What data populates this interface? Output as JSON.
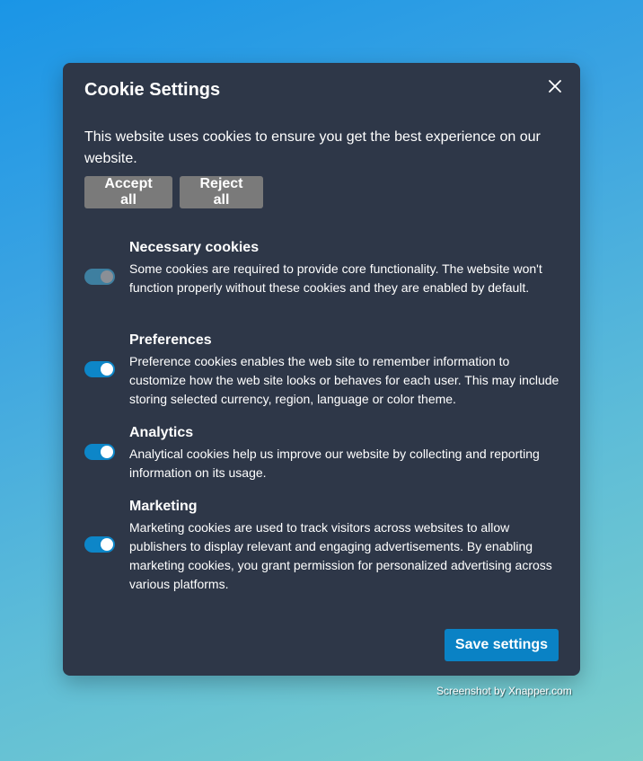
{
  "dialog": {
    "title": "Cookie Settings",
    "intro": "This website uses cookies to ensure you get the best experience on our website.",
    "accept_all_label": "Accept all",
    "reject_all_label": "Reject all",
    "close_icon": "close-icon",
    "save_label": "Save settings"
  },
  "categories": [
    {
      "title": "Necessary cookies",
      "description": "Some cookies are required to provide core functionality. The website won't function properly without these cookies and they are enabled by default.",
      "enabled": true,
      "disabled": true
    },
    {
      "title": "Preferences",
      "description": "Preference cookies enables the web site to remember information to customize how the web site looks or behaves for each user. This may include storing selected currency, region, language or color theme.",
      "enabled": true,
      "disabled": false
    },
    {
      "title": "Analytics",
      "description": "Analytical cookies help us improve our website by collecting and reporting information on its usage.",
      "enabled": true,
      "disabled": false
    },
    {
      "title": "Marketing",
      "description": "Marketing cookies are used to track visitors across websites to allow publishers to display relevant and engaging advertisements. By enabling marketing cookies, you grant permission for personalized advertising across various platforms.",
      "enabled": true,
      "disabled": false
    }
  ],
  "colors": {
    "dialog_bg": "#2e3748",
    "accent": "#0a82c5",
    "gray_button": "#7a7a7a"
  },
  "watermark": "Screenshot by Xnapper.com"
}
